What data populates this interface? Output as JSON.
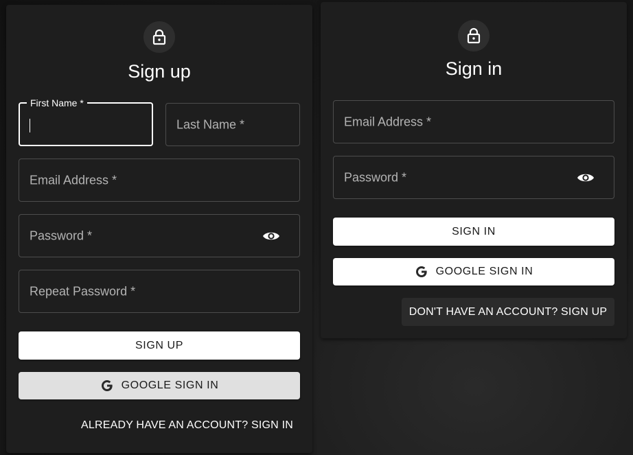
{
  "signup": {
    "title": "Sign up",
    "icon": "lock-icon",
    "fields": {
      "first_name": {
        "label": "First Name *",
        "value": ""
      },
      "last_name": {
        "label": "Last Name *",
        "value": ""
      },
      "email": {
        "label": "Email Address *",
        "value": ""
      },
      "password": {
        "label": "Password *",
        "value": ""
      },
      "repeat_password": {
        "label": "Repeat Password *",
        "value": ""
      }
    },
    "submit_label": "SIGN UP",
    "google_label": "GOOGLE SIGN IN",
    "switch_link": "ALREADY HAVE AN ACCOUNT? SIGN IN"
  },
  "signin": {
    "title": "Sign in",
    "icon": "lock-icon",
    "fields": {
      "email": {
        "label": "Email Address *",
        "value": ""
      },
      "password": {
        "label": "Password *",
        "value": ""
      }
    },
    "submit_label": "SIGN IN",
    "google_label": "GOOGLE SIGN IN",
    "switch_link": "DON'T HAVE AN ACCOUNT? SIGN UP"
  },
  "colors": {
    "background": "#141414",
    "card": "#1e1e1e",
    "field_border": "#4d4d4d",
    "button_bg": "#ffffff",
    "button_hover_bg": "#e0e0e0",
    "text_primary": "#ffffff",
    "text_secondary": "#b3b3b3"
  }
}
